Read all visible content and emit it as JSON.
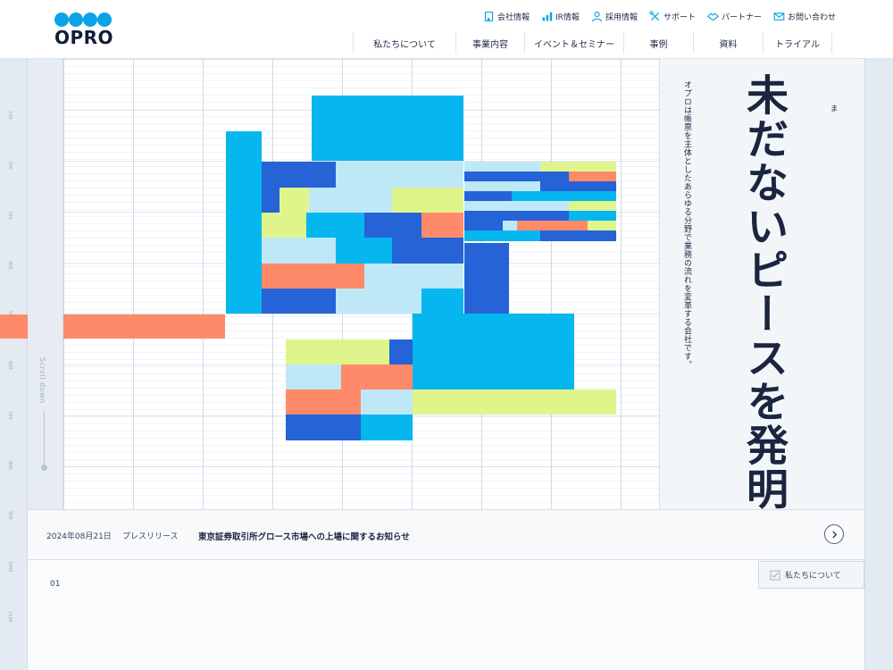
{
  "brand": {
    "logo_text": "OPRO",
    "accent": "#0aa3e6"
  },
  "utility_nav": [
    {
      "label": "会社情報",
      "icon": "building-icon"
    },
    {
      "label": "IR情報",
      "icon": "bar-chart-icon"
    },
    {
      "label": "採用情報",
      "icon": "person-icon"
    },
    {
      "label": "サポート",
      "icon": "tools-icon"
    },
    {
      "label": "パートナー",
      "icon": "handshake-icon"
    },
    {
      "label": "お問い合わせ",
      "icon": "mail-icon"
    }
  ],
  "main_nav": [
    {
      "label": "私たちについて"
    },
    {
      "label": "事業内容"
    },
    {
      "label": "イベント＆セミナー"
    },
    {
      "label": "事例"
    },
    {
      "label": "資料"
    },
    {
      "label": "トライアル"
    }
  ],
  "hero": {
    "headline": "未だないピースを発明する。",
    "ruby": "ま",
    "subcopy": "オプロは帳票を主体としたあらゆる分野で業務の流れを変革する会社です。",
    "scroll_label": "Scroll down",
    "ruler_ticks": [
      "100",
      "200",
      "300",
      "400",
      "500",
      "600",
      "700",
      "800",
      "900",
      "1000",
      "1100"
    ],
    "block_colors": {
      "cyan": "#05b6ef",
      "blue": "#2563d6",
      "light": "#bfe8f7",
      "lime": "#dff58c",
      "coral": "#ff8a6a"
    }
  },
  "news": {
    "date": "2024年08月21日",
    "category": "プレスリリース",
    "title": "東京証券取引所グロース市場への上場に関するお知らせ"
  },
  "section": {
    "number": "01",
    "tag_label": "私たちについて"
  }
}
